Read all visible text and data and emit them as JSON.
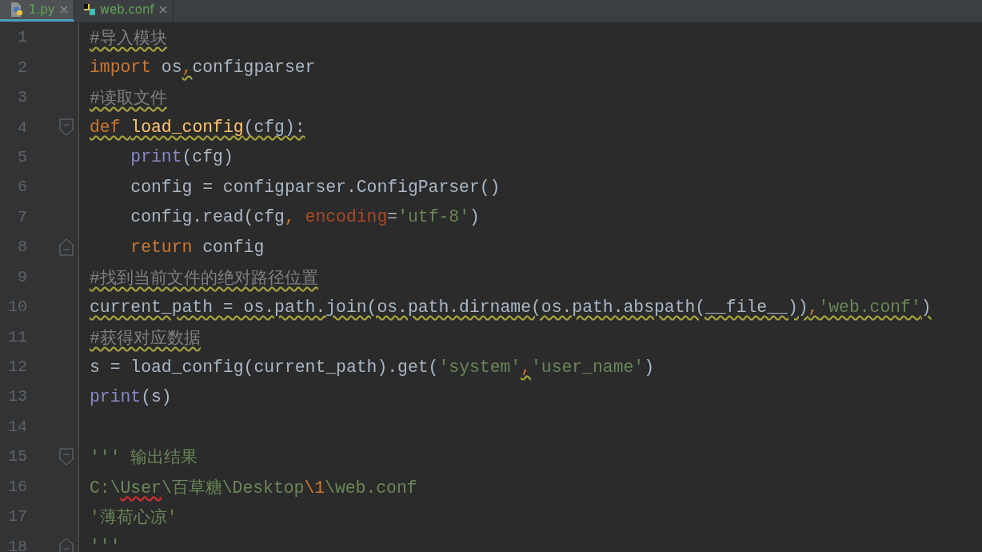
{
  "tabs": [
    {
      "label": "1.py",
      "kind": "python",
      "selected": true
    },
    {
      "label": "web.conf",
      "kind": "config",
      "selected": false
    }
  ],
  "lines": [
    {
      "number": "1",
      "kind": "code",
      "tokens": [
        {
          "text": "#导入模块",
          "kind": "comment",
          "warning": true,
          "typo": false
        }
      ]
    },
    {
      "number": "2",
      "kind": "code",
      "tokens": [
        {
          "text": "import",
          "kind": "keyword",
          "warning": false,
          "typo": false
        },
        {
          "text": " os",
          "kind": "plain",
          "warning": false,
          "typo": false
        },
        {
          "text": ",",
          "kind": "punct",
          "warning": true,
          "typo": false
        },
        {
          "text": "configparser",
          "kind": "plain",
          "warning": false,
          "typo": false
        }
      ]
    },
    {
      "number": "3",
      "kind": "code",
      "tokens": [
        {
          "text": "#读取文件",
          "kind": "comment",
          "warning": true,
          "typo": false
        }
      ]
    },
    {
      "number": "4",
      "kind": "fold_start",
      "tokens": [
        {
          "text": "def ",
          "kind": "keyword",
          "warning": true,
          "typo": false
        },
        {
          "text": "load_config",
          "kind": "func",
          "warning": true,
          "typo": false
        },
        {
          "text": "(cfg):",
          "kind": "plain",
          "warning": true,
          "typo": false
        }
      ]
    },
    {
      "number": "5",
      "kind": "code",
      "tokens": [
        {
          "text": "    print",
          "kind": "builtin",
          "warning": false,
          "typo": false
        },
        {
          "text": "(cfg)",
          "kind": "plain",
          "warning": false,
          "typo": false
        }
      ]
    },
    {
      "number": "6",
      "kind": "code",
      "tokens": [
        {
          "text": "    config = configparser.ConfigParser()",
          "kind": "plain",
          "warning": false,
          "typo": false
        }
      ]
    },
    {
      "number": "7",
      "kind": "code",
      "tokens": [
        {
          "text": "    config.read(cfg",
          "kind": "plain",
          "warning": false,
          "typo": false
        },
        {
          "text": ", ",
          "kind": "punct",
          "warning": false,
          "typo": false
        },
        {
          "text": "encoding",
          "kind": "param",
          "warning": false,
          "typo": false
        },
        {
          "text": "=",
          "kind": "plain",
          "warning": false,
          "typo": false
        },
        {
          "text": "'utf-8'",
          "kind": "string",
          "warning": false,
          "typo": false
        },
        {
          "text": ")",
          "kind": "plain",
          "warning": false,
          "typo": false
        }
      ]
    },
    {
      "number": "8",
      "kind": "fold_end",
      "tokens": [
        {
          "text": "    return",
          "kind": "keyword",
          "warning": false,
          "typo": false
        },
        {
          "text": " config",
          "kind": "plain",
          "warning": false,
          "typo": false
        }
      ]
    },
    {
      "number": "9",
      "kind": "code",
      "tokens": [
        {
          "text": "#找到当前文件的绝对路径位置",
          "kind": "comment",
          "warning": true,
          "typo": false
        }
      ]
    },
    {
      "number": "10",
      "kind": "code",
      "tokens": [
        {
          "text": "current_path = os.path.join(os.path.dirname(os.path.abspath(__file__))",
          "kind": "plain",
          "warning": true,
          "typo": false
        },
        {
          "text": ",",
          "kind": "punct",
          "warning": true,
          "typo": false
        },
        {
          "text": "'web.conf'",
          "kind": "string",
          "warning": true,
          "typo": false
        },
        {
          "text": ")",
          "kind": "plain",
          "warning": true,
          "typo": false
        }
      ]
    },
    {
      "number": "11",
      "kind": "code",
      "tokens": [
        {
          "text": "#获得对应数据",
          "kind": "comment",
          "warning": true,
          "typo": false
        }
      ]
    },
    {
      "number": "12",
      "kind": "code",
      "tokens": [
        {
          "text": "s = load_config(current_path).get(",
          "kind": "plain",
          "warning": false,
          "typo": false
        },
        {
          "text": "'system'",
          "kind": "string",
          "warning": false,
          "typo": false
        },
        {
          "text": ",",
          "kind": "punct",
          "warning": true,
          "typo": false
        },
        {
          "text": "'user_name'",
          "kind": "string",
          "warning": false,
          "typo": false
        },
        {
          "text": ")",
          "kind": "plain",
          "warning": false,
          "typo": false
        }
      ]
    },
    {
      "number": "13",
      "kind": "code",
      "tokens": [
        {
          "text": "print",
          "kind": "builtin",
          "warning": false,
          "typo": false
        },
        {
          "text": "(s)",
          "kind": "plain",
          "warning": false,
          "typo": false
        }
      ]
    },
    {
      "number": "14",
      "kind": "code"
    },
    {
      "number": "15",
      "kind": "fold_start",
      "tokens": [
        {
          "text": "''' 输出结果",
          "kind": "string",
          "warning": false,
          "typo": false
        }
      ]
    },
    {
      "number": "16",
      "kind": "code",
      "tokens": [
        {
          "text": "C:\\",
          "kind": "string",
          "warning": false,
          "typo": false
        },
        {
          "text": "User",
          "kind": "string",
          "warning": false,
          "typo": true
        },
        {
          "text": "\\百草糖\\Desktop",
          "kind": "string",
          "warning": false,
          "typo": false
        },
        {
          "text": "\\1",
          "kind": "escape",
          "warning": false,
          "typo": false
        },
        {
          "text": "\\web.conf",
          "kind": "string",
          "warning": false,
          "typo": false
        }
      ]
    },
    {
      "number": "17",
      "kind": "code",
      "tokens": [
        {
          "text": "'薄荷心凉'",
          "kind": "string",
          "warning": false,
          "typo": false
        }
      ]
    },
    {
      "number": "18",
      "kind": "fold_end",
      "tokens": [
        {
          "text": "'''",
          "kind": "string"
        }
      ]
    }
  ]
}
